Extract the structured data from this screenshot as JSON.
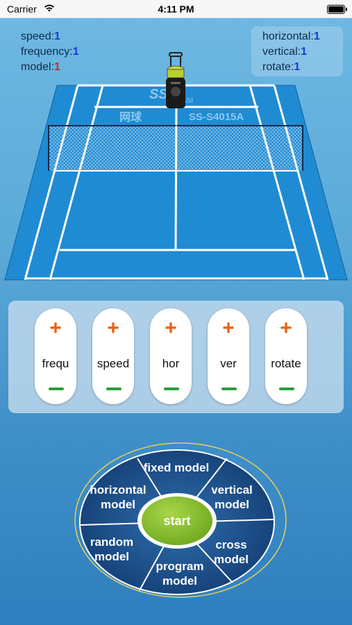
{
  "status_bar": {
    "carrier": "Carrier",
    "time": "4:11 PM"
  },
  "info_left": {
    "speed_label": "speed:",
    "speed_value": "1",
    "frequency_label": "frequency:",
    "frequency_value": "1",
    "model_label": "model:",
    "model_value": "1"
  },
  "info_right": {
    "horizontal_label": "horizontal:",
    "horizontal_value": "1",
    "vertical_label": "vertical:",
    "vertical_value": "1",
    "rotate_label": "rotate:",
    "rotate_value": "1"
  },
  "court": {
    "brand_text": "网球",
    "model_text": "SS-S4015A",
    "logo_text": "SS",
    "logo_sub": "ASI"
  },
  "controls": [
    {
      "plus": "+",
      "label": "frequ"
    },
    {
      "plus": "+",
      "label": "speed"
    },
    {
      "plus": "+",
      "label": "hor"
    },
    {
      "plus": "+",
      "label": "ver"
    },
    {
      "plus": "+",
      "label": "rotate"
    }
  ],
  "wheel": {
    "fixed": "fixed model",
    "vertical": "vertical model",
    "cross": "cross model",
    "program": "program model",
    "random": "random model",
    "horizontal": "horizontal model",
    "start": "start"
  },
  "colors": {
    "value_blue": "#1d37d8",
    "value_red": "#e02020",
    "plus_orange": "#e8620f",
    "minus_green": "#2a9d3a",
    "court_blue": "#1f8bd3",
    "start_green": "#8bc425"
  }
}
